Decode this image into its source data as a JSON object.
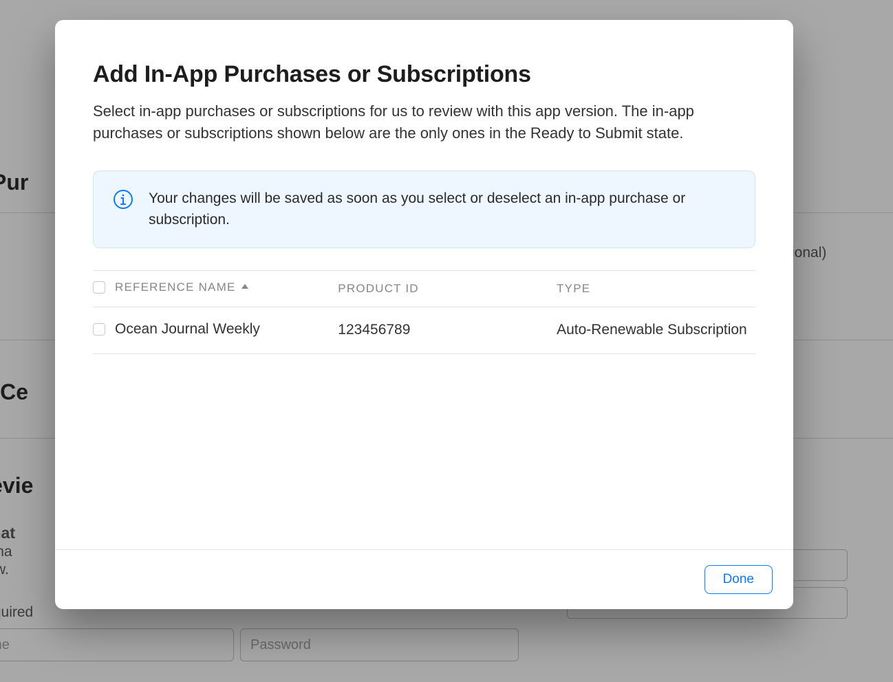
{
  "modal": {
    "title": "Add In-App Purchases or Subscriptions",
    "description": "Select in-app purchases or subscriptions for us to review with this app version. The in-app purchases or subscriptions shown below are the only ones in the Ready to Submit state.",
    "info_banner": "Your changes will be saved as soon as you select or deselect an in-app purchase or subscription.",
    "table": {
      "columns": {
        "reference_name": "Reference Name",
        "product_id": "Product ID",
        "type": "Type"
      },
      "rows": [
        {
          "reference_name": "Ocean Journal Weekly",
          "product_id": "123456789",
          "type": "Auto-Renewable Subscription"
        }
      ]
    },
    "done_label": "Done"
  },
  "background": {
    "sections": {
      "iap_heading_fragment": "pp Pur",
      "game_center_fragment": "me Ce",
      "app_review_fragment": "Revie",
      "signin_info_heading_fragment": "Informat",
      "signin_info_line1_fragment": "a user na",
      "signin_info_line2_fragment": "o review.",
      "signin_required_fragment": "-in required",
      "optional_label_fragment": "ional)"
    },
    "inputs": {
      "username_placeholder_fragment": "ame",
      "password_placeholder": "Password",
      "notes_placeholder": ""
    }
  }
}
